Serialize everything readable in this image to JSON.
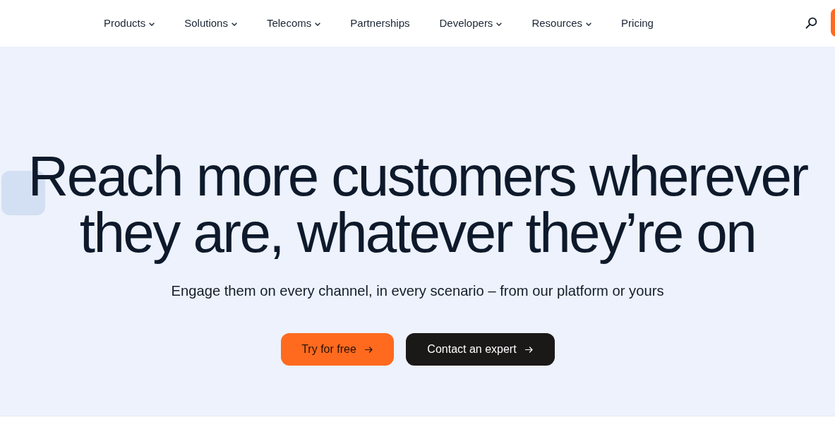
{
  "nav": {
    "items": [
      {
        "label": "Products",
        "dropdown": true
      },
      {
        "label": "Solutions",
        "dropdown": true
      },
      {
        "label": "Telecoms",
        "dropdown": true
      },
      {
        "label": "Partnerships",
        "dropdown": false
      },
      {
        "label": "Developers",
        "dropdown": true
      },
      {
        "label": "Resources",
        "dropdown": true
      },
      {
        "label": "Pricing",
        "dropdown": false
      }
    ]
  },
  "hero": {
    "headline": "Reach more customers wherever they are, whatever they’re on",
    "subtitle": "Engage them on every channel, in every scenario – from our platform or yours",
    "buttons": [
      {
        "label": "Try for free",
        "kind": "primary"
      },
      {
        "label": "Contact an expert",
        "kind": "secondary"
      }
    ]
  }
}
